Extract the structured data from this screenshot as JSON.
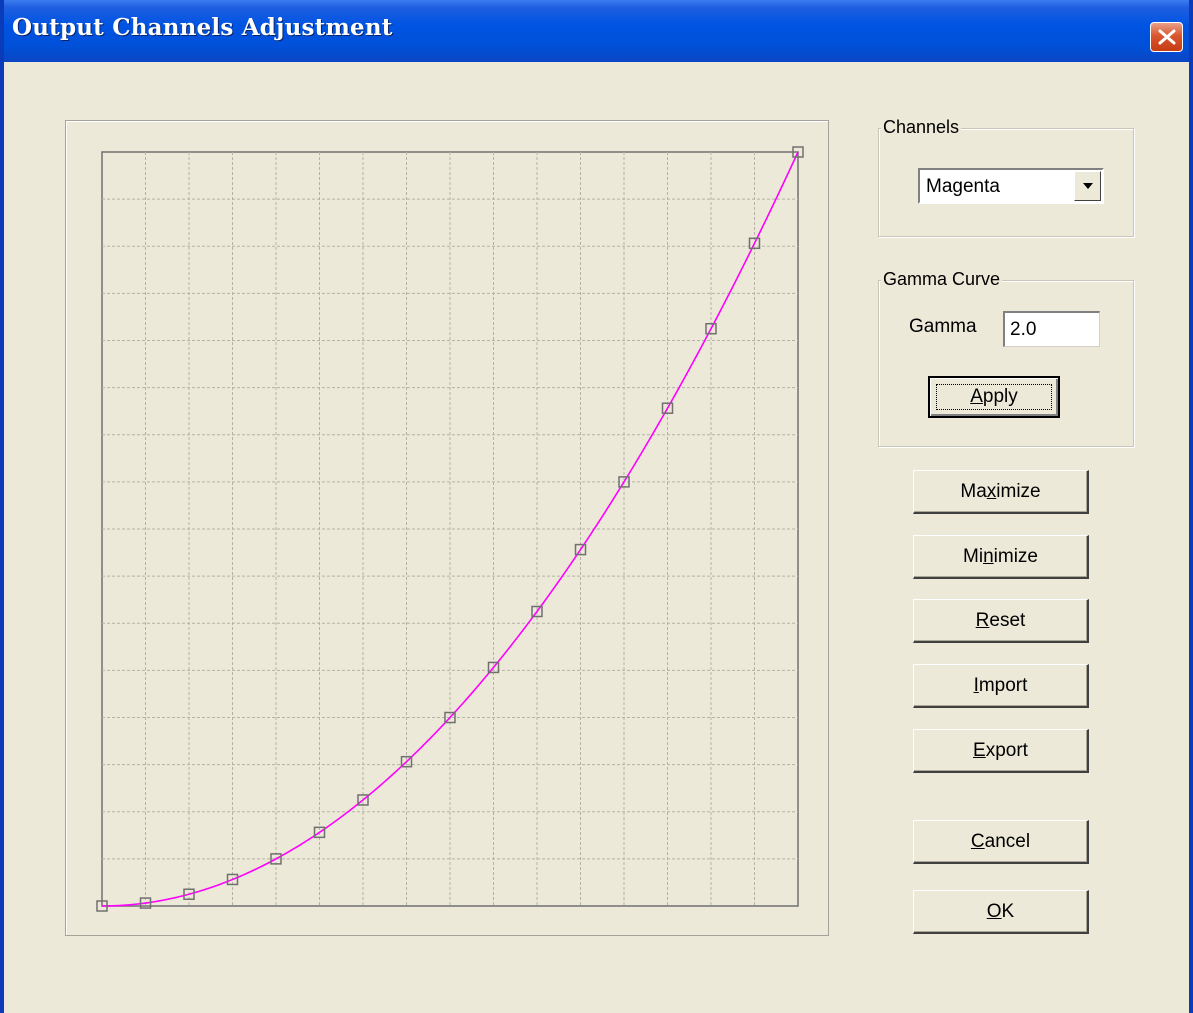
{
  "window": {
    "title": "Output Channels Adjustment",
    "close_icon": "close-x-icon"
  },
  "channels": {
    "group_label": "Channels",
    "selected": "Magenta"
  },
  "gamma_curve": {
    "group_label": "Gamma Curve",
    "gamma_label": "Gamma",
    "gamma_value": "2.0",
    "apply": {
      "before": "",
      "key": "A",
      "after": "pply"
    }
  },
  "buttons": {
    "maximize": {
      "before": "Ma",
      "key": "x",
      "after": "imize"
    },
    "minimize": {
      "before": "Mi",
      "key": "n",
      "after": "imize"
    },
    "reset": {
      "before": "",
      "key": "R",
      "after": "eset"
    },
    "import": {
      "before": "",
      "key": "I",
      "after": "mport"
    },
    "export": {
      "before": "",
      "key": "E",
      "after": "xport"
    },
    "cancel": {
      "before": "",
      "key": "C",
      "after": "ancel"
    },
    "ok": {
      "before": "",
      "key": "O",
      "after": "K"
    }
  },
  "colors": {
    "curve": "#FF00FF",
    "grid": "#B4B2A8",
    "control_point": "#707070",
    "window_bg": "#ECE9D8"
  },
  "chart_data": {
    "type": "line",
    "gamma": 2.0,
    "xlim": [
      0,
      1
    ],
    "ylim": [
      0,
      1
    ],
    "grid": "dashed 16x16",
    "control_points_x": [
      0,
      0.0625,
      0.125,
      0.1875,
      0.25,
      0.3125,
      0.375,
      0.4375,
      0.5,
      0.5625,
      0.625,
      0.6875,
      0.75,
      0.8125,
      0.875,
      0.9375,
      1.0
    ],
    "control_points_y": [
      0,
      0.0039,
      0.0156,
      0.0352,
      0.0625,
      0.0977,
      0.1406,
      0.1914,
      0.25,
      0.3164,
      0.3906,
      0.4727,
      0.5625,
      0.6602,
      0.7656,
      0.8789,
      1.0
    ]
  }
}
